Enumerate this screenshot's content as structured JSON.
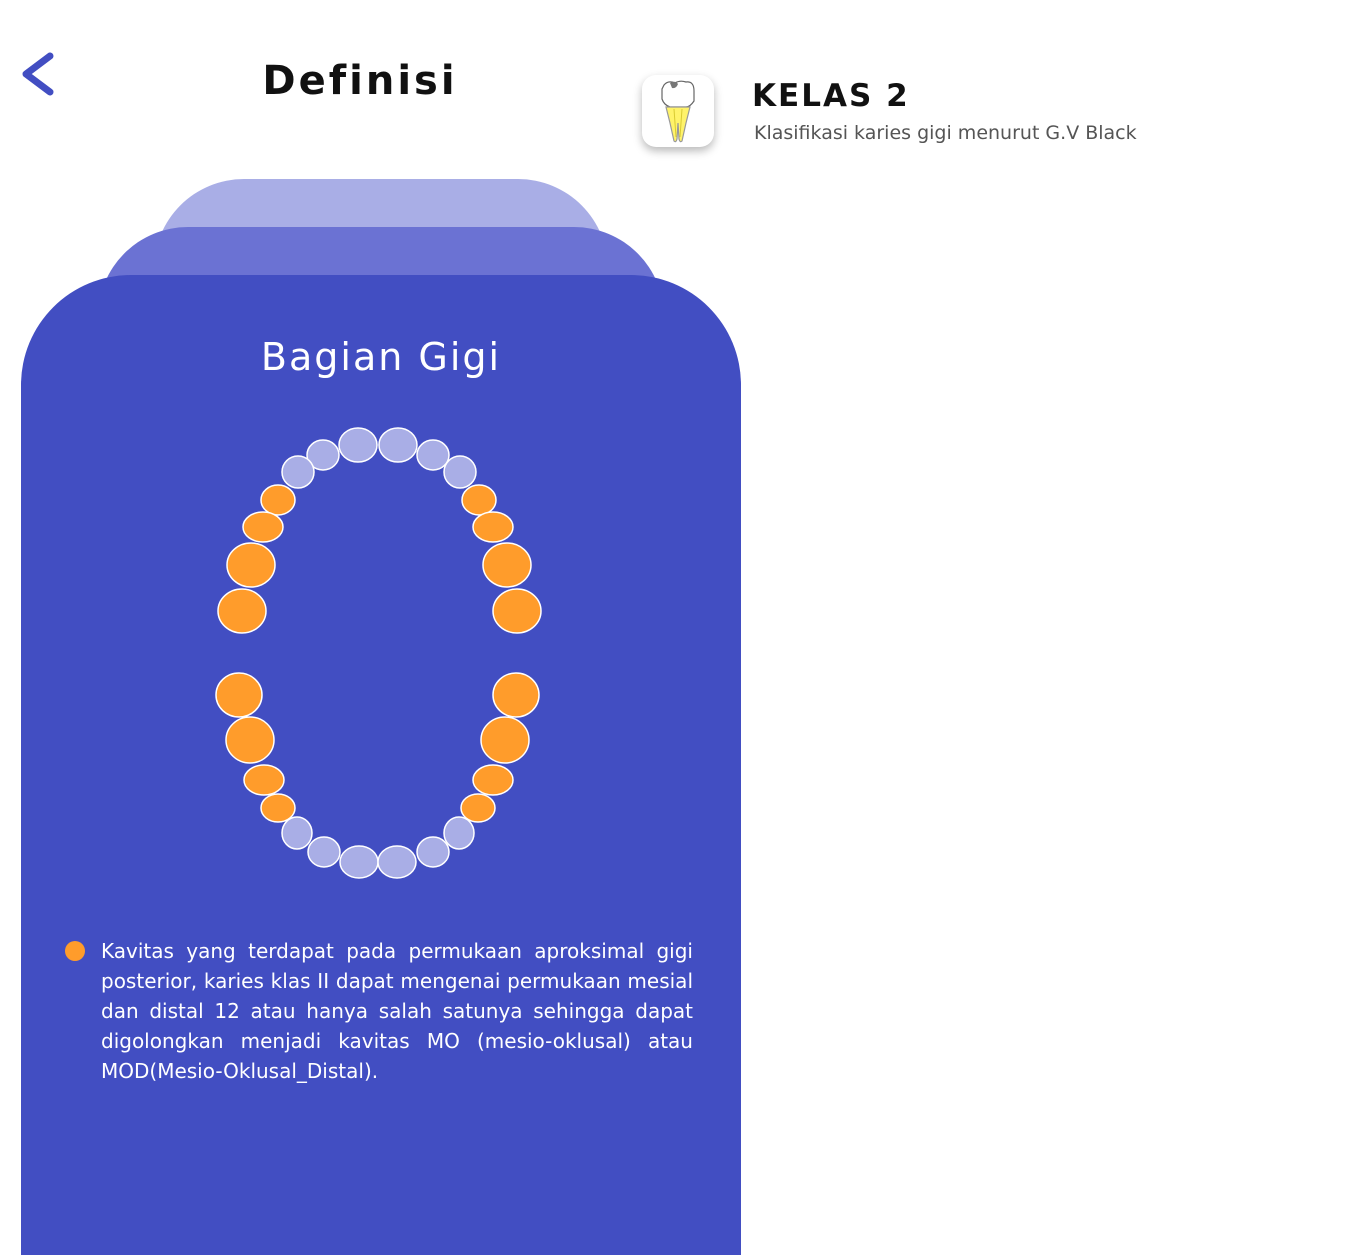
{
  "header": {
    "back_icon": "chevron-left-icon",
    "title": "Definisi"
  },
  "app_info": {
    "icon": "tooth-icon",
    "title": "KELAS 2",
    "subtitle": "Klasifikasi karies gigi menurut G.V Black"
  },
  "card": {
    "title": "Bagian Gigi",
    "description": "Kavitas yang terdapat pada permukaan aproksimal gigi posterior, karies klas II dapat mengenai permukaan mesial dan distal 12 atau hanya salah satunya sehingga dapat digolongkan menjadi kavitas MO (mesio-oklusal) atau MOD(Mesio-Oklusal_Distal)."
  },
  "colors": {
    "accent": "#424ec2",
    "tab_mid": "#6b72d3",
    "tab_back": "#a9aee6",
    "highlight_teeth": "#ff9c2b",
    "normal_teeth": "#a9aee6"
  }
}
